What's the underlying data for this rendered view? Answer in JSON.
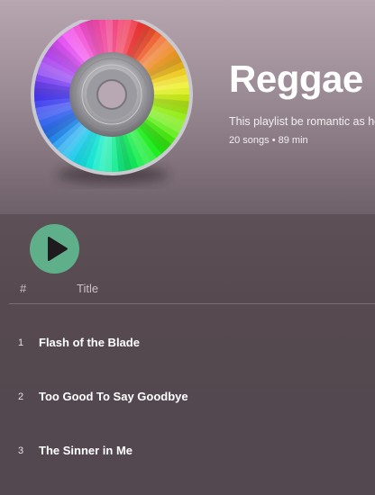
{
  "playlist": {
    "title": "Reggae",
    "description": "This playlist be romantic as he",
    "meta": "20 songs • 89 min",
    "cover_icon": "rainbow-disc-icon"
  },
  "controls": {
    "play_icon": "play-icon"
  },
  "table": {
    "col_number": "#",
    "col_title": "Title"
  },
  "tracks": [
    {
      "number": "1",
      "title": "Flash of the Blade"
    },
    {
      "number": "2",
      "title": "Too Good To Say Goodbye"
    },
    {
      "number": "3",
      "title": "The Sinner in Me"
    }
  ],
  "colors": {
    "accent": "#5fb08a"
  }
}
